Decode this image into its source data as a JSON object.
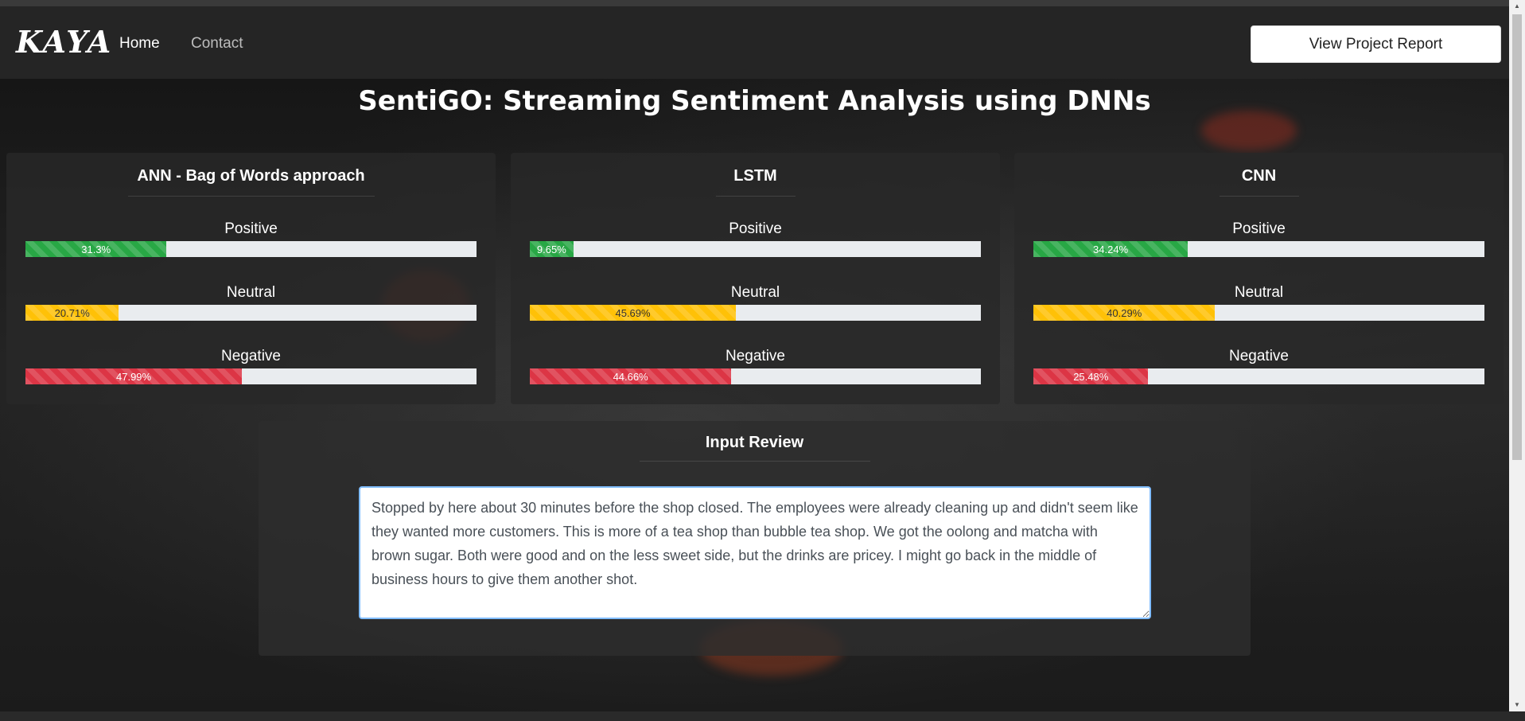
{
  "navbar": {
    "brand": "KAYA",
    "links": [
      "Home",
      "Contact"
    ],
    "report_button": "View Project Report"
  },
  "page_title": "SentiGO: Streaming Sentiment Analysis using DNNs",
  "models": [
    {
      "title": "ANN - Bag of Words approach",
      "metrics": [
        {
          "label": "Positive",
          "value_text": "31.3%",
          "value": 31.3
        },
        {
          "label": "Neutral",
          "value_text": "20.71%",
          "value": 20.71
        },
        {
          "label": "Negative",
          "value_text": "47.99%",
          "value": 47.99
        }
      ]
    },
    {
      "title": "LSTM",
      "metrics": [
        {
          "label": "Positive",
          "value_text": "9.65%",
          "value": 9.65
        },
        {
          "label": "Neutral",
          "value_text": "45.69%",
          "value": 45.69
        },
        {
          "label": "Negative",
          "value_text": "44.66%",
          "value": 44.66
        }
      ]
    },
    {
      "title": "CNN",
      "metrics": [
        {
          "label": "Positive",
          "value_text": "34.24%",
          "value": 34.24
        },
        {
          "label": "Neutral",
          "value_text": "40.29%",
          "value": 40.29
        },
        {
          "label": "Negative",
          "value_text": "25.48%",
          "value": 25.48
        }
      ]
    }
  ],
  "input_review": {
    "title": "Input Review",
    "text": "Stopped by here about 30 minutes before the shop closed. The employees were already cleaning up and didn't seem like they wanted more customers. This is more of a tea shop than bubble tea shop. We got the oolong and matcha with brown sugar. Both were good and on the less sweet side, but the drinks are pricey. I might go back in the middle of business hours to give them another shot."
  },
  "colors": {
    "positive": "#28a745",
    "neutral": "#ffc107",
    "negative": "#dc3545",
    "accent_border": "#80bdff"
  }
}
